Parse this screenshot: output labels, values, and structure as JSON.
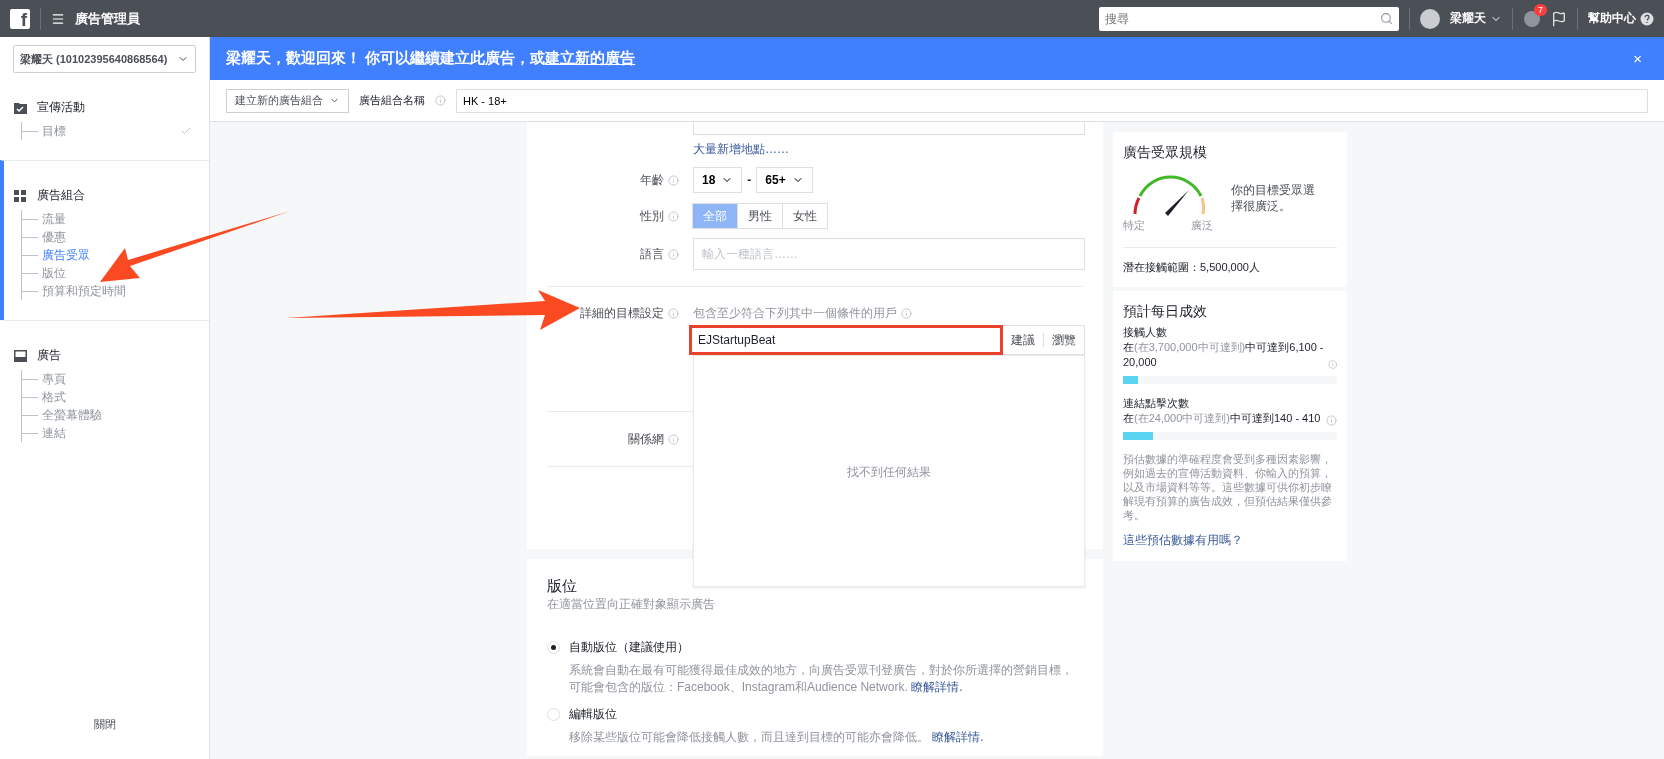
{
  "top_bar": {
    "logo": "f",
    "title": "廣告管理員",
    "search": {
      "placeholder": "搜尋"
    },
    "user": "梁耀天",
    "notifications": "7",
    "help": "幫助中心"
  },
  "account": "梁耀天 (10102395640868564)",
  "banner": {
    "text": "梁耀天，歡迎回來！ 你可以繼續建立此廣告，或",
    "link": "建立新的廣告",
    "close": "×"
  },
  "sub_bar": {
    "ad_set_button": "建立新的廣告組合",
    "name_label": "廣告組合名稱",
    "name_value": "HK - 18+"
  },
  "sidebar": {
    "sections": [
      {
        "title": "宣傳活動",
        "selected": false,
        "items": [
          {
            "label": "目標",
            "selected": false,
            "done": true
          }
        ]
      },
      {
        "title": "廣告組合",
        "selected": true,
        "items": [
          {
            "label": "流量",
            "selected": false,
            "done": false
          },
          {
            "label": "優惠",
            "selected": false,
            "done": false
          },
          {
            "label": "廣告受眾",
            "selected": true,
            "done": false
          },
          {
            "label": "版位",
            "selected": false,
            "done": false
          },
          {
            "label": "預算和預定時間",
            "selected": false,
            "done": false
          }
        ]
      },
      {
        "title": "廣告",
        "selected": false,
        "items": [
          {
            "label": "專頁",
            "selected": false,
            "done": false
          },
          {
            "label": "格式",
            "selected": false,
            "done": false
          },
          {
            "label": "全螢幕體驗",
            "selected": false,
            "done": false
          },
          {
            "label": "連結",
            "selected": false,
            "done": false
          }
        ]
      }
    ],
    "close": "關閉"
  },
  "audience_form": {
    "bulk_locations_link": "大量新增地點……",
    "age": {
      "label": "年齡",
      "min": "18",
      "separator": "-",
      "max": "65+"
    },
    "gender": {
      "label": "性別",
      "options": [
        {
          "label": "全部",
          "selected": true
        },
        {
          "label": "男性",
          "selected": false
        },
        {
          "label": "女性",
          "selected": false
        }
      ]
    },
    "language": {
      "label": "語言",
      "placeholder": "輸入一種語言……"
    },
    "detailed_targeting": {
      "label": "詳細的目標設定",
      "hint": "包含至少符合下列其中一個條件的用戶",
      "value": "EJStartupBeat",
      "suggest": "建議",
      "browse": "瀏覽",
      "no_results": "找不到任何結果"
    },
    "connections": {
      "label": "關係網"
    }
  },
  "placement": {
    "title": "版位",
    "subtitle": "在適當位置向正確對象顯示廣告",
    "options": [
      {
        "label": "自動版位（建議使用）",
        "description": "系統會自動在最有可能獲得最佳成效的地方，向廣告受眾刊登廣告，對於你所選擇的營銷目標，可能會包含的版位：Facebook、Instagram和Audience Network.",
        "link": "瞭解詳情.",
        "selected": true
      },
      {
        "label": "編輯版位",
        "description": "移除某些版位可能會降低接觸人數，而且達到目標的可能亦會降低。",
        "link": "瞭解詳情.",
        "selected": false
      }
    ]
  },
  "audience_size": {
    "title": "廣告受眾規模",
    "low": "特定",
    "high": "廣泛",
    "description": "你的目標受眾選擇很廣泛。",
    "reach": "潛在接觸範圍：5,500,000人"
  },
  "estimates": {
    "title": "預計每日成效",
    "metrics": [
      {
        "label": "接觸人數",
        "prefix": "在",
        "range": "(在3,700,000中可達到)",
        "result": "中可達到6,100 - 20,000",
        "level": 0.07
      },
      {
        "label": "連結點擊次數",
        "prefix": "在",
        "range": "(在24,000中可達到)",
        "result": "中可達到140 - 410",
        "level": 0.14
      }
    ],
    "note": "預估數據的準確程度會受到多種因素影響，例如過去的宣傳活動資料、你輸入的預算，以及市場資料等等。這些數據可供你初步瞭解現有預算的廣告成效，但預估結果僅供參考。",
    "link": "這些預估數據有用嗎？"
  }
}
